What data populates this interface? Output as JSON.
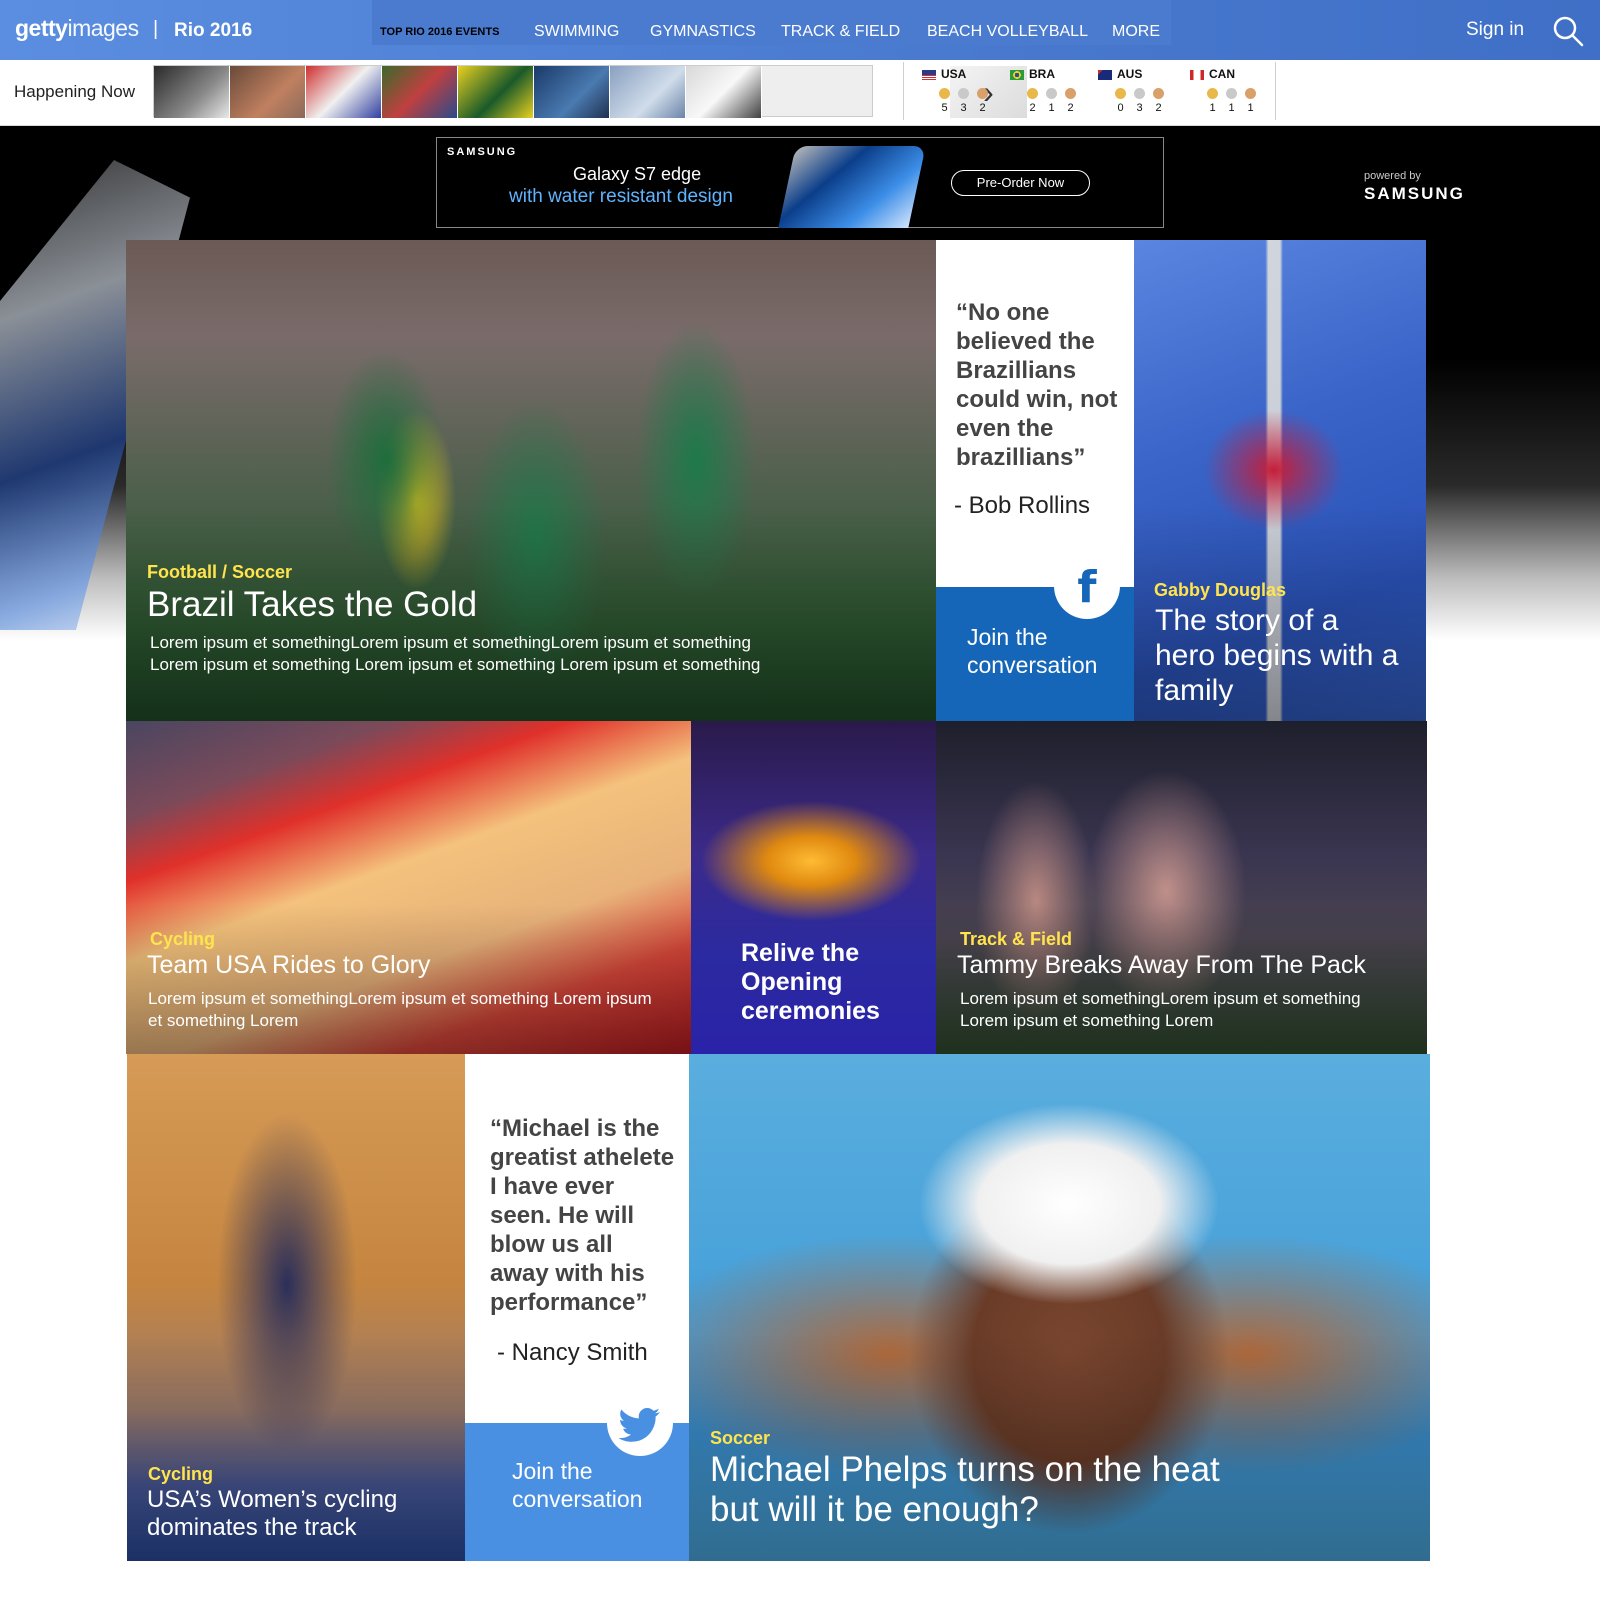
{
  "header": {
    "logo_bold": "getty",
    "logo_light": "images",
    "pipe": "|",
    "section": "Rio 2016",
    "nav": [
      "TOP RIO 2016 EVENTS",
      "SWIMMING",
      "GYMNASTICS",
      "TRACK & FIELD",
      "BEACH VOLLEYBALL",
      "MORE"
    ],
    "signin": "Sign in",
    "search_icon": "search-icon"
  },
  "happening": {
    "label": "Happening Now",
    "thumbnail_count": 10,
    "next_icon": "chevron-right-icon",
    "next_glyph": "›"
  },
  "medals": [
    {
      "code": "USA",
      "counts": [
        "5",
        "3",
        "2"
      ]
    },
    {
      "code": "BRA",
      "counts": [
        "2",
        "1",
        "2"
      ]
    },
    {
      "code": "AUS",
      "counts": [
        "0",
        "3",
        "2"
      ]
    },
    {
      "code": "CAN",
      "counts": [
        "1",
        "1",
        "1"
      ]
    }
  ],
  "medal_colors": {
    "gold": "#e9b84a",
    "silver": "#c9c9c9",
    "bronze": "#d9a06a"
  },
  "ad": {
    "brand": "SAMSUNG",
    "line1": "Galaxy S7 edge",
    "line2": "with water resistant design",
    "cta": "Pre-Order Now",
    "powered_by": "powered by",
    "powered_brand": "SAMSUNG"
  },
  "tiles": {
    "hero": {
      "category": "Football / Soccer",
      "headline": "Brazil Takes the Gold",
      "body": "Lorem ipsum et somethingLorem ipsum et somethingLorem ipsum et something Lorem ipsum et something Lorem ipsum et something Lorem ipsum et something"
    },
    "quote1": {
      "quote": "“No one believed the Brazillians could win, not even the brazillians”",
      "author": "- Bob Rollins",
      "join": "Join the conversation",
      "icon": "facebook-icon",
      "icon_glyph": "f"
    },
    "gabby": {
      "category": "Gabby Douglas",
      "headline": "The story of a hero begins with a family"
    },
    "cycling": {
      "category": "Cycling",
      "headline": "Team USA Rides to Glory",
      "body": "Lorem ipsum et somethingLorem ipsum et something Lorem ipsum et something Lorem"
    },
    "opening": {
      "headline": "Relive the Opening ceremonies"
    },
    "tammy": {
      "category": "Track & Field",
      "headline": "Tammy Breaks Away From The Pack",
      "body": "Lorem ipsum et somethingLorem ipsum et something Lorem ipsum et something Lorem"
    },
    "women": {
      "category": "Cycling",
      "headline": "USA’s Women’s cycling dominates the track"
    },
    "quote2": {
      "quote": "“Michael is the greatist athelete I have ever seen. He will blow us all away with his performance”",
      "author": "- Nancy Smith",
      "join": "Join the conversation",
      "icon": "twitter-icon"
    },
    "phelps": {
      "category": "Soccer",
      "headline": "Michael Phelps turns on the heat but will it be enough?"
    }
  },
  "colors": {
    "accent_blue": "#4a7bcf",
    "facebook_blue": "#1565b8",
    "twitter_blue": "#4a90e2",
    "category_yellow": "#ffe44d"
  }
}
